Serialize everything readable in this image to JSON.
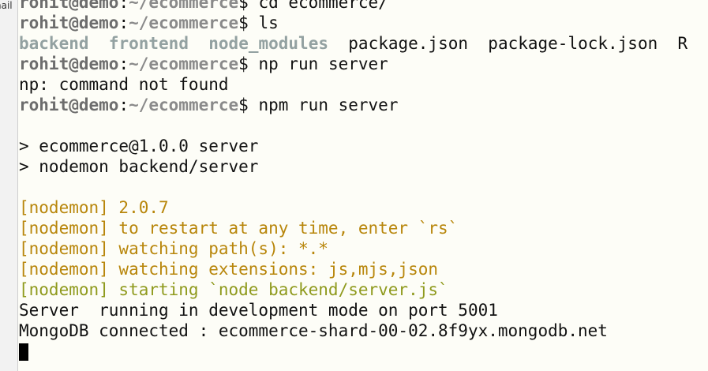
{
  "sidebar": {
    "label": "nail"
  },
  "prompt": {
    "user": "rohit@demo",
    "sep": ":",
    "path": "~/ecommerce",
    "symbol": "$ "
  },
  "commands": {
    "cd": "cd ecommerce/",
    "ls": "ls",
    "np": "np run server",
    "npm": "npm run server"
  },
  "ls_output": {
    "dirs": [
      "backend",
      "frontend",
      "node_modules"
    ],
    "files": [
      "package.json",
      "package-lock.json",
      "R"
    ]
  },
  "messages": {
    "not_found": "np: command not found",
    "npm_script": "> ecommerce@1.0.0 server",
    "npm_cmd": "> nodemon backend/server",
    "nodemon_version": "[nodemon] 2.0.7",
    "nodemon_restart": "[nodemon] to restart at any time, enter `rs`",
    "nodemon_watch_path": "[nodemon] watching path(s): *.*",
    "nodemon_watch_ext": "[nodemon] watching extensions: js,mjs,json",
    "nodemon_start": "[nodemon] starting `node backend/server.js`",
    "server_running": "Server  running in development mode on port 5001",
    "mongo_connected": "MongoDB connected : ecommerce-shard-00-02.8f9yx.mongodb.net"
  }
}
